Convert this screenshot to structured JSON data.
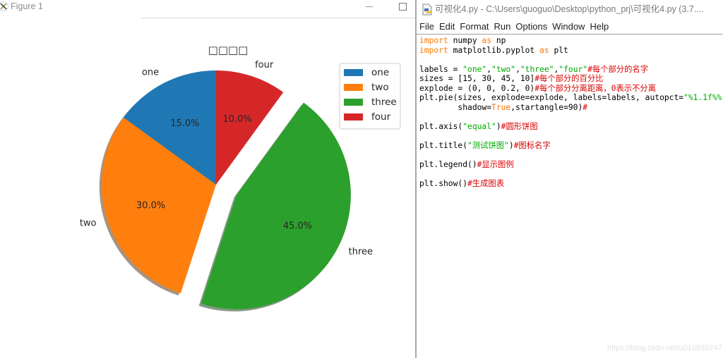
{
  "figure_window": {
    "title": "Figure 1"
  },
  "editor_window": {
    "title": "可视化4.py - C:\\Users\\guoguo\\Desktop\\python_prj\\可视化4.py (3.7....",
    "menu": [
      "File",
      "Edit",
      "Format",
      "Run",
      "Options",
      "Window",
      "Help"
    ],
    "code_lines": [
      [
        {
          "t": "kw",
          "text": "import"
        },
        {
          "t": "plain",
          "text": " numpy "
        },
        {
          "t": "kw",
          "text": "as"
        },
        {
          "t": "plain",
          "text": " np"
        }
      ],
      [
        {
          "t": "kw",
          "text": "import"
        },
        {
          "t": "plain",
          "text": " matplotlib.pyplot "
        },
        {
          "t": "kw",
          "text": "as"
        },
        {
          "t": "plain",
          "text": " plt"
        }
      ],
      [],
      [
        {
          "t": "plain",
          "text": "labels = "
        },
        {
          "t": "str",
          "text": "\"one\""
        },
        {
          "t": "plain",
          "text": ","
        },
        {
          "t": "str",
          "text": "\"two\""
        },
        {
          "t": "plain",
          "text": ","
        },
        {
          "t": "str",
          "text": "\"three\""
        },
        {
          "t": "plain",
          "text": ","
        },
        {
          "t": "str",
          "text": "\"four\""
        },
        {
          "t": "comment",
          "text": "#每个部分的名字"
        }
      ],
      [
        {
          "t": "plain",
          "text": "sizes = [15, 30, 45, 10]"
        },
        {
          "t": "comment",
          "text": "#每个部分的百分比"
        }
      ],
      [
        {
          "t": "plain",
          "text": "explode = (0, 0, 0.2, 0)"
        },
        {
          "t": "comment",
          "text": "#每个部分分离距离，0表示不分离"
        }
      ],
      [
        {
          "t": "plain",
          "text": "plt.pie(sizes, explode=explode, labels=labels, autopct="
        },
        {
          "t": "str",
          "text": "\"%1.1f%%"
        }
      ],
      [
        {
          "t": "plain",
          "text": "        shadow="
        },
        {
          "t": "kw",
          "text": "True"
        },
        {
          "t": "plain",
          "text": ",startangle=90)"
        },
        {
          "t": "comment",
          "text": "#"
        }
      ],
      [],
      [
        {
          "t": "plain",
          "text": "plt.axis("
        },
        {
          "t": "str",
          "text": "\"equal\""
        },
        {
          "t": "plain",
          "text": ")"
        },
        {
          "t": "comment",
          "text": "#圆形饼图"
        }
      ],
      [],
      [
        {
          "t": "plain",
          "text": "plt.title("
        },
        {
          "t": "str",
          "text": "\"测试饼图\""
        },
        {
          "t": "plain",
          "text": ")"
        },
        {
          "t": "comment",
          "text": "#图标名字"
        }
      ],
      [],
      [
        {
          "t": "plain",
          "text": "plt.legend()"
        },
        {
          "t": "comment",
          "text": "#显示图例"
        }
      ],
      [],
      [
        {
          "t": "plain",
          "text": "plt.show()"
        },
        {
          "t": "comment",
          "text": "#生成图表"
        }
      ]
    ]
  },
  "syntax_colors": {
    "keyword": "#ff7700",
    "string": "#00aa00",
    "comment": "#dd0000",
    "plain": "#000000"
  },
  "watermark": "https://blog.csdn.net/u010835747",
  "chart_data": {
    "type": "pie",
    "title": "□□□□",
    "labels": [
      "one",
      "two",
      "three",
      "four"
    ],
    "values": [
      15,
      30,
      45,
      10
    ],
    "percent_labels": [
      "15.0%",
      "30.0%",
      "45.0%",
      "10.0%"
    ],
    "explode": [
      0,
      0,
      0.2,
      0
    ],
    "start_angle": 90,
    "shadow": true,
    "colors": [
      "#1f77b4",
      "#ff7f0e",
      "#2ca02c",
      "#d62728"
    ],
    "legend": {
      "entries": [
        "one",
        "two",
        "three",
        "four"
      ],
      "position": "upper-right"
    }
  }
}
